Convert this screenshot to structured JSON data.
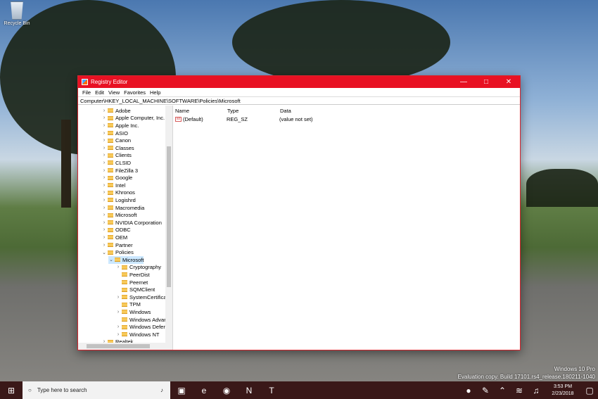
{
  "desktop": {
    "recycle_bin": "Recycle Bin",
    "watermark_line1": "Windows 10 Pro",
    "watermark_line2": "Evaluation copy. Build 17101.rs4_release.180211-1040"
  },
  "window": {
    "title": "Registry Editor",
    "menu": [
      "File",
      "Edit",
      "View",
      "Favorites",
      "Help"
    ],
    "address": "Computer\\HKEY_LOCAL_MACHINE\\SOFTWARE\\Policies\\Microsoft",
    "tree": [
      {
        "label": "Adobe",
        "expander": "›"
      },
      {
        "label": "Apple Computer, Inc.",
        "expander": "›"
      },
      {
        "label": "Apple Inc.",
        "expander": "›"
      },
      {
        "label": "ASIO",
        "expander": "›"
      },
      {
        "label": "Canon",
        "expander": "›"
      },
      {
        "label": "Classes",
        "expander": "›"
      },
      {
        "label": "Clients",
        "expander": "›"
      },
      {
        "label": "CLSID",
        "expander": "›"
      },
      {
        "label": "FileZilla 3",
        "expander": "›"
      },
      {
        "label": "Google",
        "expander": "›"
      },
      {
        "label": "Intel",
        "expander": "›"
      },
      {
        "label": "Khronos",
        "expander": "›"
      },
      {
        "label": "Logishrd",
        "expander": "›"
      },
      {
        "label": "Macromedia",
        "expander": "›"
      },
      {
        "label": "Microsoft",
        "expander": "›"
      },
      {
        "label": "NVIDIA Corporation",
        "expander": "›"
      },
      {
        "label": "ODBC",
        "expander": "›"
      },
      {
        "label": "OEM",
        "expander": "›"
      },
      {
        "label": "Partner",
        "expander": "›"
      },
      {
        "label": "Policies",
        "expander": "⌄"
      },
      {
        "label": "Microsoft",
        "expander": "⌄"
      },
      {
        "label": "Cryptography",
        "expander": "›"
      },
      {
        "label": "PeerDist",
        "expander": ""
      },
      {
        "label": "Peernet",
        "expander": ""
      },
      {
        "label": "SQMClient",
        "expander": ""
      },
      {
        "label": "SystemCertifica",
        "expander": "›"
      },
      {
        "label": "TPM",
        "expander": ""
      },
      {
        "label": "Windows",
        "expander": "›"
      },
      {
        "label": "Windows Advar",
        "expander": ""
      },
      {
        "label": "Windows Defer",
        "expander": "›"
      },
      {
        "label": "Windows NT",
        "expander": "›"
      },
      {
        "label": "Realtek",
        "expander": "›"
      }
    ],
    "columns": [
      "Name",
      "Type",
      "Data"
    ],
    "value_row": {
      "icon": "ab",
      "name": "(Default)",
      "type": "REG_SZ",
      "data": "(value not set)"
    }
  },
  "taskbar": {
    "search_placeholder": "Type here to search",
    "time": "3:53 PM",
    "date": "2/23/2018"
  }
}
